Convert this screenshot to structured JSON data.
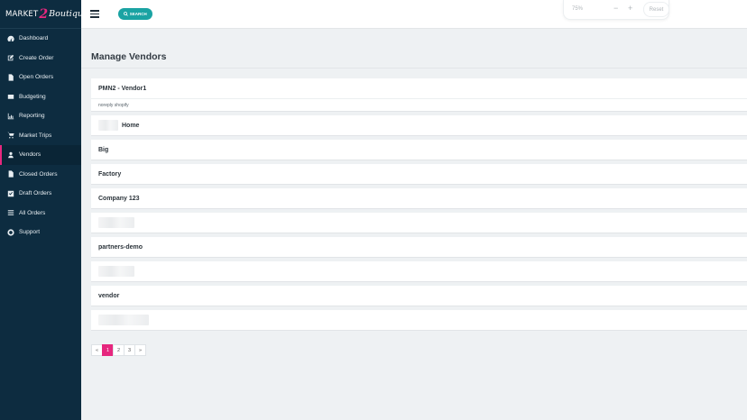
{
  "logo": {
    "part1": "MARKET",
    "part2": "2",
    "part3": "Boutique"
  },
  "sidebar": {
    "items": [
      {
        "label": "Dashboard",
        "icon": "dashboard-icon"
      },
      {
        "label": "Create Order",
        "icon": "edit-icon"
      },
      {
        "label": "Open Orders",
        "icon": "file-icon"
      },
      {
        "label": "Budgeting",
        "icon": "budget-icon"
      },
      {
        "label": "Reporting",
        "icon": "chart-icon"
      },
      {
        "label": "Market Trips",
        "icon": "cart-icon"
      },
      {
        "label": "Vendors",
        "icon": "user-icon",
        "active": true
      },
      {
        "label": "Closed Orders",
        "icon": "file-icon"
      },
      {
        "label": "Draft Orders",
        "icon": "checkbox-icon"
      },
      {
        "label": "All Orders",
        "icon": "list-icon"
      },
      {
        "label": "Support",
        "icon": "support-icon"
      }
    ]
  },
  "topbar": {
    "search_label": "SEARCH",
    "zoom_level": "75%",
    "zoom_minus": "−",
    "zoom_plus": "+",
    "reset_label": "Reset"
  },
  "page": {
    "title": "Manage Vendors"
  },
  "vendors": [
    {
      "name": "PMN2 - Vendor1",
      "subtitle": "noreply shopify",
      "has_logo": false
    },
    {
      "name": "Home",
      "subtitle": "",
      "has_logo": true
    },
    {
      "name": "Big",
      "subtitle": "",
      "has_logo": false
    },
    {
      "name": "Factory",
      "subtitle": "",
      "has_logo": false
    },
    {
      "name": "Company 123",
      "subtitle": "",
      "has_logo": false
    },
    {
      "name": "",
      "subtitle": "",
      "has_logo": true
    },
    {
      "name": "partners-demo",
      "subtitle": "",
      "has_logo": false
    },
    {
      "name": "",
      "subtitle": "",
      "has_logo": true
    },
    {
      "name": "vendor",
      "subtitle": "",
      "has_logo": false
    },
    {
      "name": "",
      "subtitle": "",
      "has_logo": true
    }
  ],
  "pagination": {
    "prev": "«",
    "pages": [
      "1",
      "2",
      "3"
    ],
    "current": "1",
    "next": "»"
  },
  "colors": {
    "sidebar": "#0d2c40",
    "accent": "#e6277e",
    "search": "#1aa3a3"
  }
}
